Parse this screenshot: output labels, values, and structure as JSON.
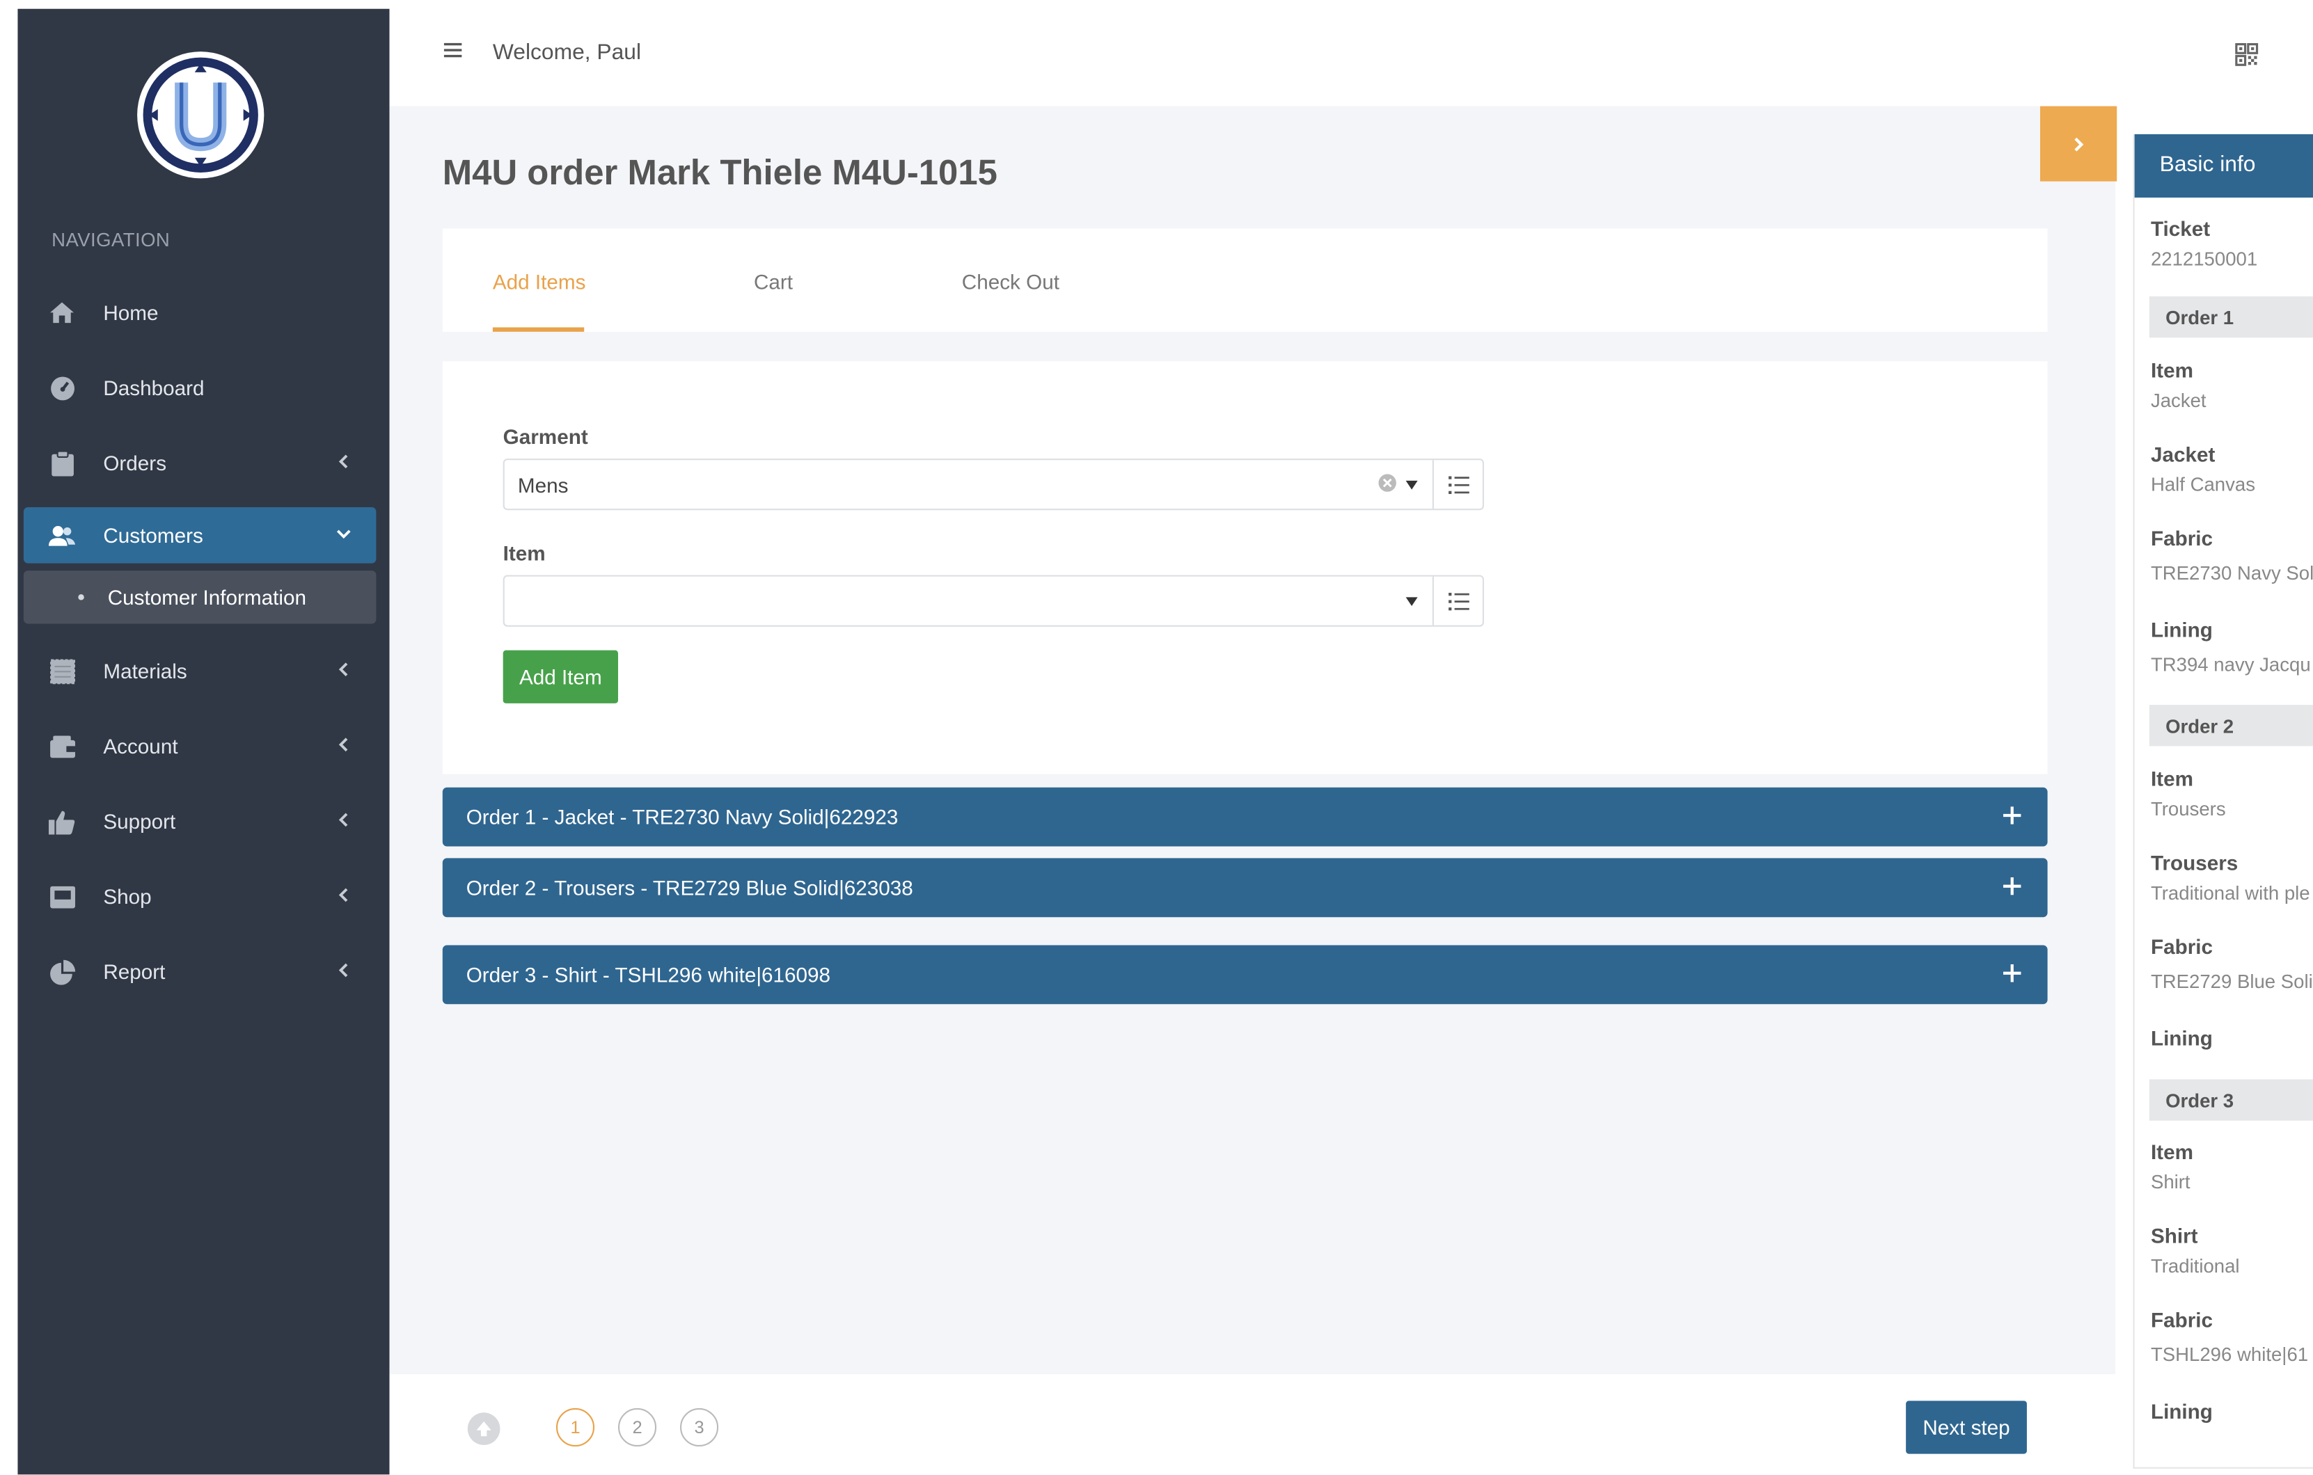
{
  "sidebar": {
    "heading": "NAVIGATION",
    "items": [
      {
        "label": "Home",
        "icon": "home-icon"
      },
      {
        "label": "Dashboard",
        "icon": "dashboard-icon"
      },
      {
        "label": "Orders",
        "icon": "clipboard-icon"
      },
      {
        "label": "Customers",
        "icon": "users-icon"
      },
      {
        "label": "Materials",
        "icon": "fabric-icon"
      },
      {
        "label": "Account",
        "icon": "wallet-icon"
      },
      {
        "label": "Support",
        "icon": "thumbs-up-icon"
      },
      {
        "label": "Shop",
        "icon": "shop-icon"
      },
      {
        "label": "Report",
        "icon": "pie-chart-icon"
      }
    ],
    "active_item": "Customers",
    "sub_item": "Customer Information"
  },
  "header": {
    "welcome": "Welcome, Paul"
  },
  "page": {
    "title": "M4U order Mark Thiele M4U-1015"
  },
  "tabs": [
    {
      "label": "Add Items",
      "active": true
    },
    {
      "label": "Cart",
      "active": false
    },
    {
      "label": "Check Out",
      "active": false
    }
  ],
  "form": {
    "garment_label": "Garment",
    "garment_value": "Mens",
    "item_label": "Item",
    "item_value": "",
    "add_button": "Add Item"
  },
  "orders": [
    {
      "label": "Order 1 - Jacket - TRE2730 Navy Solid|622923"
    },
    {
      "label": "Order 2 - Trousers - TRE2729 Blue Solid|623038"
    },
    {
      "label": "Order 3 - Shirt - TSHL296 white|616098"
    }
  ],
  "wizard": {
    "steps": [
      "1",
      "2",
      "3"
    ],
    "current_step": 1,
    "next_button": "Next step"
  },
  "basic_info": {
    "title": "Basic info",
    "ticket_label": "Ticket",
    "ticket_value": "2212150001",
    "order1": {
      "heading": "Order 1",
      "item_label": "Item",
      "item_value": "Jacket",
      "jacket_label": "Jacket",
      "jacket_value": "Half Canvas",
      "fabric_label": "Fabric",
      "fabric_value": "TRE2730 Navy Sol",
      "lining_label": "Lining",
      "lining_value": "TR394 navy Jacqu"
    },
    "order2": {
      "heading": "Order 2",
      "item_label": "Item",
      "item_value": "Trousers",
      "trousers_label": "Trousers",
      "trousers_value": "Traditional with ple",
      "fabric_label": "Fabric",
      "fabric_value": "TRE2729 Blue Soli",
      "lining_label": "Lining"
    },
    "order3": {
      "heading": "Order 3",
      "item_label": "Item",
      "item_value": "Shirt",
      "shirt_label": "Shirt",
      "shirt_value": "Traditional",
      "fabric_label": "Fabric",
      "fabric_value": "TSHL296 white|61",
      "lining_label": "Lining"
    }
  },
  "colors": {
    "sidebar_bg": "#313845",
    "active_blue": "#2f6b97",
    "accent_orange": "#e9a24a",
    "add_green": "#47a14a",
    "accordion_blue": "#2f6690"
  }
}
